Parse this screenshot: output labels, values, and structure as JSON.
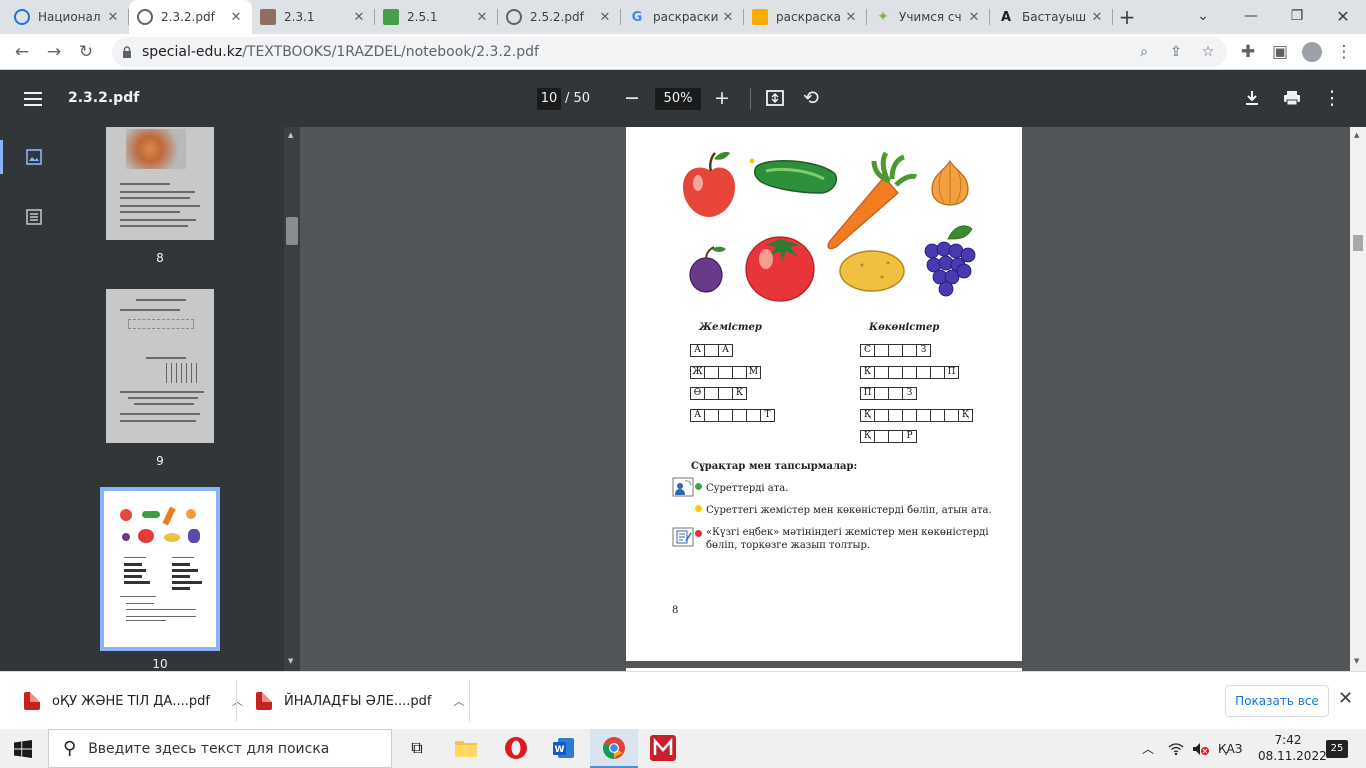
{
  "tabs": [
    {
      "title": "Национал",
      "fav": "globe",
      "color": "#1a73e8"
    },
    {
      "title": "2.3.2.pdf",
      "fav": "globe",
      "color": "#5f6368",
      "active": true
    },
    {
      "title": "2.3.1",
      "fav": "image",
      "color": "#8d6e63"
    },
    {
      "title": "2.5.1",
      "fav": "image",
      "color": "#43a047"
    },
    {
      "title": "2.5.2.pdf",
      "fav": "globe",
      "color": "#5f6368"
    },
    {
      "title": "раскраски",
      "fav": "G",
      "color": "#4285f4"
    },
    {
      "title": "раскраска",
      "fav": "image",
      "color": "#f9ab00"
    },
    {
      "title": "Учимся сч",
      "fav": "puzzle",
      "color": "#7cb342"
    },
    {
      "title": "Бастауыш",
      "fav": "A",
      "color": "#202124"
    }
  ],
  "url": {
    "host": "special-edu.kz",
    "path": "/TEXTBOOKS/1RAZDEL/notebook/2.3.2.pdf"
  },
  "pdf": {
    "filename": "2.3.2.pdf",
    "page": "10",
    "total": "/ 50",
    "zoom": "50%"
  },
  "thumbnails": [
    {
      "num": "8"
    },
    {
      "num": "9"
    },
    {
      "num": "10"
    }
  ],
  "exercise": {
    "fruits_title": "Жемістер",
    "veg_title": "Көкөністер",
    "fruits": [
      [
        "А",
        "",
        "А"
      ],
      [
        "Ж",
        "",
        "",
        "",
        "М"
      ],
      [
        "Ө",
        "",
        "",
        "К"
      ],
      [
        "А",
        "",
        "",
        "",
        "",
        "Т"
      ]
    ],
    "vegetables": [
      [
        "С",
        "",
        "",
        "",
        "З"
      ],
      [
        "К",
        "",
        "",
        "",
        "",
        "",
        "П"
      ],
      [
        "П",
        "",
        "",
        "З"
      ],
      [
        "Қ",
        "",
        "",
        "",
        "",
        "",
        "",
        "Қ"
      ],
      [
        "Қ",
        "",
        "",
        "Р"
      ]
    ],
    "questions_title": "Сұрақтар мен тапсырмалар:",
    "q1": "Суреттерді ата.",
    "q2": "Суреттегі жемістер мен көкөністерді бөліп, атын ата.",
    "q3a": "«Күзгі еңбек» мәтініндегі жемістер мен көкөністерді",
    "q3b": "бөліп,   торкөзге жазып толтыр.",
    "page_number": "8",
    "colors": {
      "green": "#3aa84a",
      "yellow": "#f5d000",
      "red": "#e03030"
    }
  },
  "downloads": [
    {
      "name": "оҚУ ЖӘНЕ ТІЛ ДА....pdf"
    },
    {
      "name": "ЙНАЛАДҒЫ ӘЛЕ....pdf"
    }
  ],
  "show_all": "Показать все",
  "taskbar": {
    "search_placeholder": "Введите здесь текст для поиска",
    "lang": "ҚАЗ",
    "time": "7:42",
    "date": "08.11.2022",
    "notifications": "25"
  }
}
